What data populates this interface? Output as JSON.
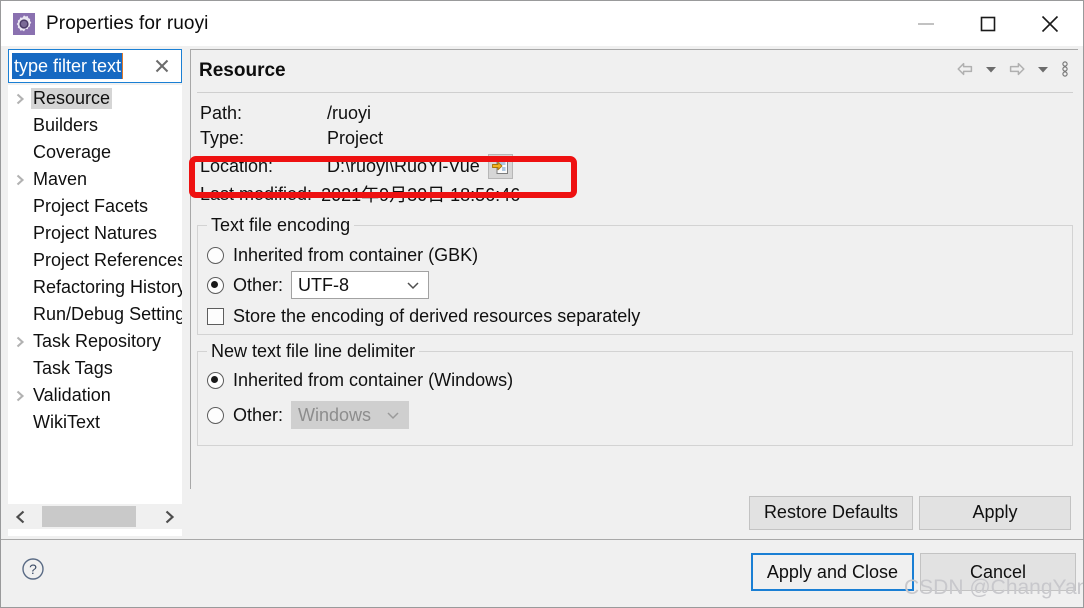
{
  "window": {
    "title": "Properties for ruoyi",
    "icon": "gear-icon",
    "minimize_label": "Minimize",
    "maximize_label": "Maximize",
    "close_label": "Close"
  },
  "filter": {
    "value": "type filter text",
    "placeholder": "type filter text",
    "clear_label": "×"
  },
  "tree": {
    "items": [
      {
        "label": "Resource",
        "expandable": true,
        "selected": true
      },
      {
        "label": "Builders",
        "expandable": false,
        "selected": false
      },
      {
        "label": "Coverage",
        "expandable": false,
        "selected": false
      },
      {
        "label": "Maven",
        "expandable": true,
        "selected": false
      },
      {
        "label": "Project Facets",
        "expandable": false,
        "selected": false
      },
      {
        "label": "Project Natures",
        "expandable": false,
        "selected": false
      },
      {
        "label": "Project References",
        "expandable": false,
        "selected": false
      },
      {
        "label": "Refactoring History",
        "expandable": false,
        "selected": false
      },
      {
        "label": "Run/Debug Settings",
        "expandable": false,
        "selected": false
      },
      {
        "label": "Task Repository",
        "expandable": true,
        "selected": false
      },
      {
        "label": "Task Tags",
        "expandable": false,
        "selected": false
      },
      {
        "label": "Validation",
        "expandable": true,
        "selected": false
      },
      {
        "label": "WikiText",
        "expandable": false,
        "selected": false
      }
    ],
    "scroll_left_label": "‹",
    "scroll_right_label": "›"
  },
  "page": {
    "title": "Resource",
    "nav": {
      "back_label": "Back",
      "back_menu_label": "Back history",
      "forward_label": "Forward",
      "forward_menu_label": "Forward history",
      "menu_label": "View menu"
    },
    "fields": {
      "path_label": "Path:",
      "path_value": "/ruoyi",
      "type_label": "Type:",
      "type_value": "Project",
      "location_label": "Location:",
      "location_value": "D:\\ruoyi\\RuoYi-Vue",
      "location_button_label": "Show in system explorer",
      "modified_label": "Last modified:",
      "modified_value": "2021年9月30日 18:56:46"
    },
    "encoding_group": {
      "title": "Text file encoding",
      "inherited_label": "Inherited from container (GBK)",
      "inherited_selected": false,
      "other_label": "Other:",
      "other_selected": true,
      "other_value": "UTF-8",
      "store_label": "Store the encoding of derived resources separately",
      "store_checked": false
    },
    "delimiter_group": {
      "title": "New text file line delimiter",
      "inherited_label": "Inherited from container (Windows)",
      "inherited_selected": true,
      "other_label": "Other:",
      "other_selected": false,
      "other_value": "Windows",
      "other_disabled": true
    }
  },
  "buttons": {
    "restore_defaults": "Restore Defaults",
    "apply": "Apply",
    "apply_and_close": "Apply and Close",
    "cancel": "Cancel",
    "help_label": "?"
  },
  "annotation": {
    "color": "#ee1111",
    "target": "location-row"
  },
  "watermark": {
    "text": "CSDN @ChangYan."
  }
}
